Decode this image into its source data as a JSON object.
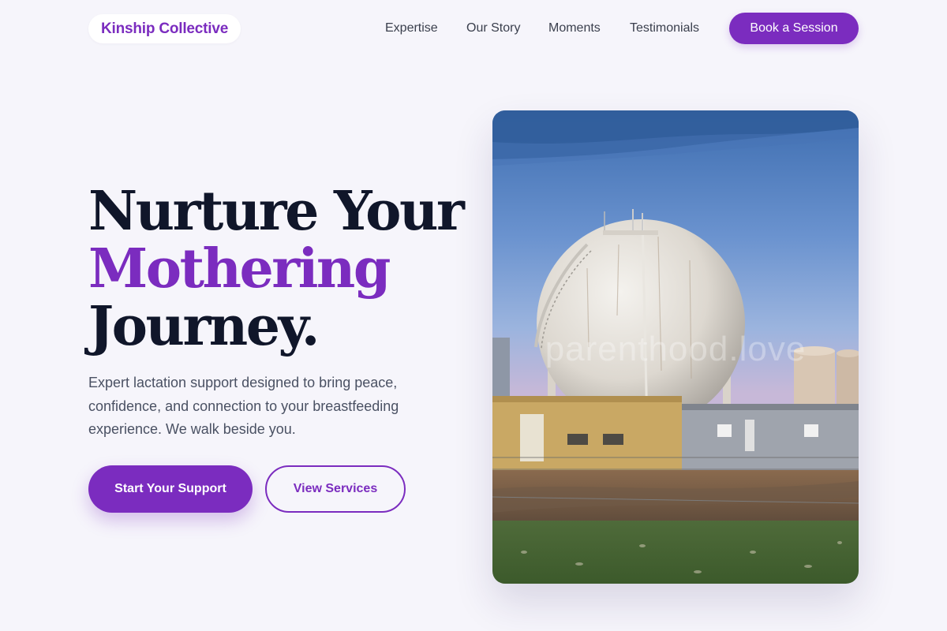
{
  "brand": {
    "name": "Kinship Collective"
  },
  "nav": {
    "items": [
      {
        "label": "Expertise"
      },
      {
        "label": "Our Story"
      },
      {
        "label": "Moments"
      },
      {
        "label": "Testimonials"
      }
    ],
    "cta_label": "Book a Session"
  },
  "hero": {
    "headline": {
      "line1": "Nurture Your",
      "line2": "Mothering",
      "line3": "Journey."
    },
    "lead": "Expert lactation support designed to bring peace, confidence, and connection to your breastfeeding experience. We walk beside you.",
    "primary_button": "Start Your Support",
    "secondary_button": "View Services",
    "image": {
      "subject": "industrial spherical storage tank beside buildings under blue sky",
      "watermark": "parenthood.love"
    }
  },
  "colors": {
    "accent": "#7b2cbf",
    "background": "#f6f5fb",
    "headline": "#10162a",
    "body_text": "#4a5163"
  }
}
